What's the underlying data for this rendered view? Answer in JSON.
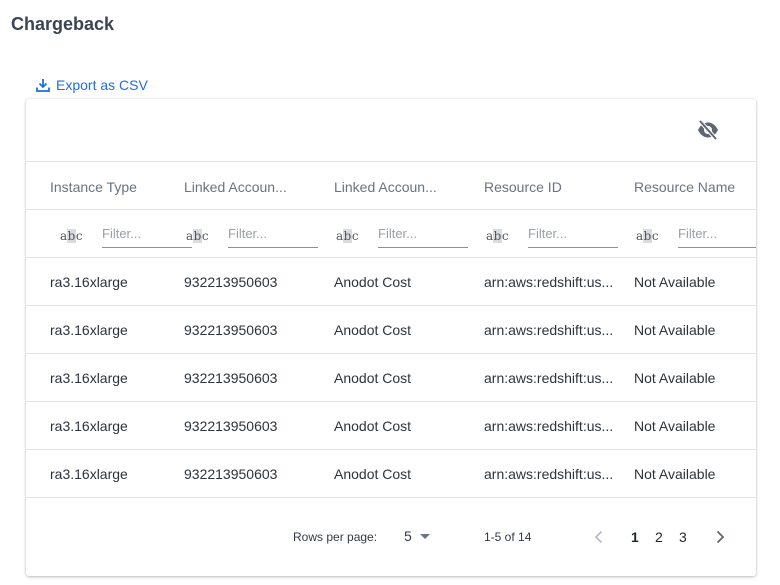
{
  "page": {
    "title": "Chargeback"
  },
  "toolbar": {
    "export_label": "Export as CSV",
    "hide_columns_icon": "eye-off-icon"
  },
  "table": {
    "columns": [
      "Instance Type",
      "Linked Accoun...",
      "Linked Accoun...",
      "Resource ID",
      "Resource Name"
    ],
    "filter_placeholder": "Filter...",
    "filter_icon": "abc-text-filter-icon",
    "rows": [
      [
        "ra3.16xlarge",
        "932213950603",
        "Anodot Cost",
        "arn:aws:redshift:us...",
        "Not Available"
      ],
      [
        "ra3.16xlarge",
        "932213950603",
        "Anodot Cost",
        "arn:aws:redshift:us...",
        "Not Available"
      ],
      [
        "ra3.16xlarge",
        "932213950603",
        "Anodot Cost",
        "arn:aws:redshift:us...",
        "Not Available"
      ],
      [
        "ra3.16xlarge",
        "932213950603",
        "Anodot Cost",
        "arn:aws:redshift:us...",
        "Not Available"
      ],
      [
        "ra3.16xlarge",
        "932213950603",
        "Anodot Cost",
        "arn:aws:redshift:us...",
        "Not Available"
      ]
    ]
  },
  "pagination": {
    "rows_per_page_label": "Rows per page:",
    "rows_per_page_value": "5",
    "range_text": "1-5 of 14",
    "pages": [
      "1",
      "2",
      "3"
    ],
    "current_page": "1"
  },
  "colors": {
    "accent": "#1d6fe0",
    "title": "#3b4552",
    "header_text": "#6b7380",
    "divider": "#e2e4e8"
  }
}
